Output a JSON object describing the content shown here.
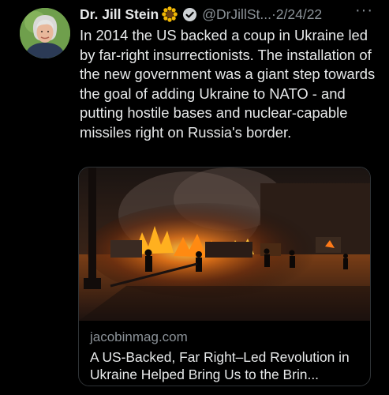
{
  "tweet": {
    "author_name": "Dr. Jill Stein",
    "handle": "@DrJillSt...",
    "separator": "·",
    "date": "2/24/22",
    "more_label": "···",
    "text": "In 2014 the US backed a coup in Ukraine led by far-right insurrectionists. The installation of the new government was a giant step towards the goal of adding Ukraine to NATO - and putting hostile bases and nuclear-capable missiles right on Russia's border.",
    "icons": {
      "avatar": "profile-photo",
      "name_emoji": "sunflower-icon",
      "badge": "verified-badge-icon"
    }
  },
  "link_card": {
    "image": "burning-street-photo",
    "domain": "jacobinmag.com",
    "title": "A US-Backed, Far Right–Led Revolution in Ukraine Helped Bring Us to the Brin..."
  },
  "colors": {
    "background": "#000000",
    "text_primary": "#e7e9ea",
    "text_secondary": "#8b9298",
    "card_border": "#2f3336"
  }
}
